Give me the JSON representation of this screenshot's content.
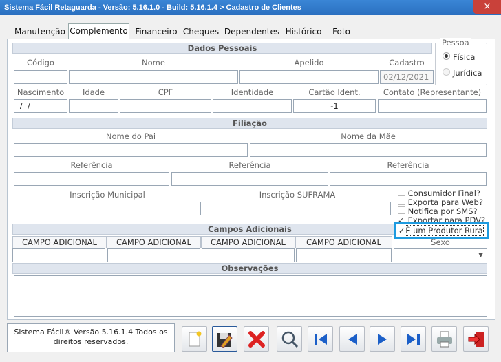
{
  "window": {
    "title": "Sistema Fácil Retaguarda - Versão: 5.16.1.0  - Build: 5.16.1.4 > Cadastro de Clientes",
    "close_label": "×"
  },
  "tabs": [
    "Manutenção",
    "Complemento",
    "Financeiro",
    "Cheques",
    "Dependentes",
    "Histórico",
    "Foto"
  ],
  "active_tab": "Complemento",
  "dados_pessoais": {
    "title": "Dados Pessoais",
    "codigo_label": "Código",
    "codigo_value": "",
    "nome_label": "Nome",
    "nome_value": "",
    "apelido_label": "Apelido",
    "apelido_value": "",
    "cadastro_label": "Cadastro",
    "cadastro_value": "02/12/2021",
    "nascimento_label": "Nascimento",
    "nascimento_value": " /  /",
    "idade_label": "Idade",
    "idade_value": "",
    "cpf_label": "CPF",
    "cpf_value": "",
    "identidade_label": "Identidade",
    "identidade_value": "",
    "cartao_label": "Cartão Ident.",
    "cartao_value": "-1",
    "contato_label": "Contato (Representante)",
    "contato_value": ""
  },
  "pessoa": {
    "title": "Pessoa",
    "options": [
      "Física",
      "Jurídica"
    ],
    "selected": "Física"
  },
  "filiacao": {
    "title": "Filiação",
    "pai_label": "Nome do Pai",
    "mae_label": "Nome da Mãe",
    "ref1_label": "Referência",
    "ref2_label": "Referência",
    "ref3_label": "Referência",
    "insc_municipal_label": "Inscrição Municipal",
    "insc_suframa_label": "Inscrição SUFRAMA"
  },
  "checkboxes": [
    {
      "label": "Consumidor Final?",
      "checked": false
    },
    {
      "label": "Exporta para Web?",
      "checked": false
    },
    {
      "label": "Notifica por SMS?",
      "checked": false
    },
    {
      "label": "Exportar para PDV?",
      "checked": true
    },
    {
      "label": "É um Produtor Rura",
      "checked": true
    }
  ],
  "campos_adicionais": {
    "title": "Campos Adicionais",
    "columns": [
      "CAMPO ADICIONAL",
      "CAMPO ADICIONAL",
      "CAMPO ADICIONAL",
      "CAMPO ADICIONAL"
    ]
  },
  "sexo": {
    "label": "Sexo",
    "value": ""
  },
  "observacoes": {
    "title": "Observações",
    "value": ""
  },
  "status_text": "Sistema Fácil® Versão 5.16.1.4 Todos os direitos reservados.",
  "toolbar": [
    "new-icon",
    "save-icon",
    "delete-icon",
    "search-icon",
    "first-icon",
    "prev-icon",
    "next-icon",
    "last-icon",
    "print-icon",
    "exit-icon"
  ]
}
